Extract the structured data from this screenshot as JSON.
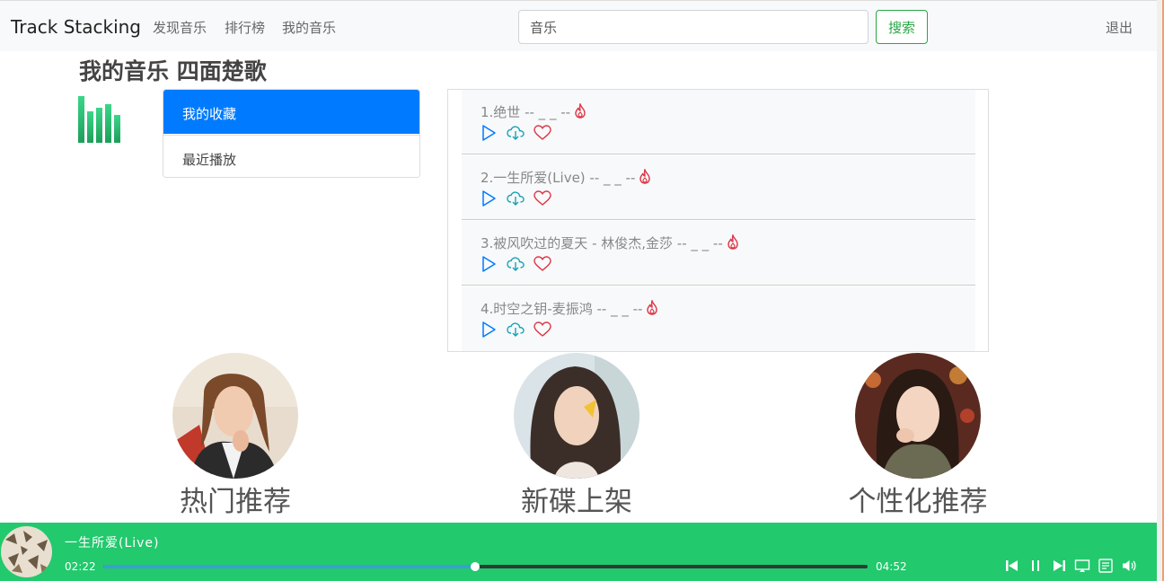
{
  "navbar": {
    "brand": "Track Stacking",
    "links": [
      "发现音乐",
      "排行榜",
      "我的音乐"
    ],
    "search_value": "音乐",
    "search_button": "搜索",
    "logout": "退出"
  },
  "page": {
    "title": "我的音乐 四面楚歌"
  },
  "side_menu": {
    "items": [
      "我的收藏",
      "最近播放"
    ],
    "active_index": 0
  },
  "songs": [
    {
      "label": "1.绝世 -- _ _ --"
    },
    {
      "label": "2.一生所爱(Live) -- _ _ --"
    },
    {
      "label": "3.被风吹过的夏天 - 林俊杰,金莎 -- _ _ --"
    },
    {
      "label": "4.时空之钥-麦振鸿 -- _ _ --"
    }
  ],
  "recommendations": [
    {
      "label": "热门推荐"
    },
    {
      "label": "新碟上架"
    },
    {
      "label": "个性化推荐"
    }
  ],
  "player": {
    "title": "一生所爱(Live)",
    "current_time": "02:22",
    "total_time": "04:52",
    "progress_fraction": 0.487
  },
  "colors": {
    "primary": "#007bff",
    "success": "#28a745",
    "player_bg": "#22c96d",
    "heart": "#dc3545",
    "play": "#007bff",
    "download": "#17a2b8"
  },
  "icons": {
    "song_actions": [
      "play-icon",
      "download-cloud-icon",
      "heart-icon"
    ],
    "title_badge": "fire-icon",
    "player_controls": [
      "skip-back-icon",
      "pause-icon",
      "skip-forward-icon",
      "cast-icon",
      "playlist-icon",
      "volume-icon"
    ]
  }
}
